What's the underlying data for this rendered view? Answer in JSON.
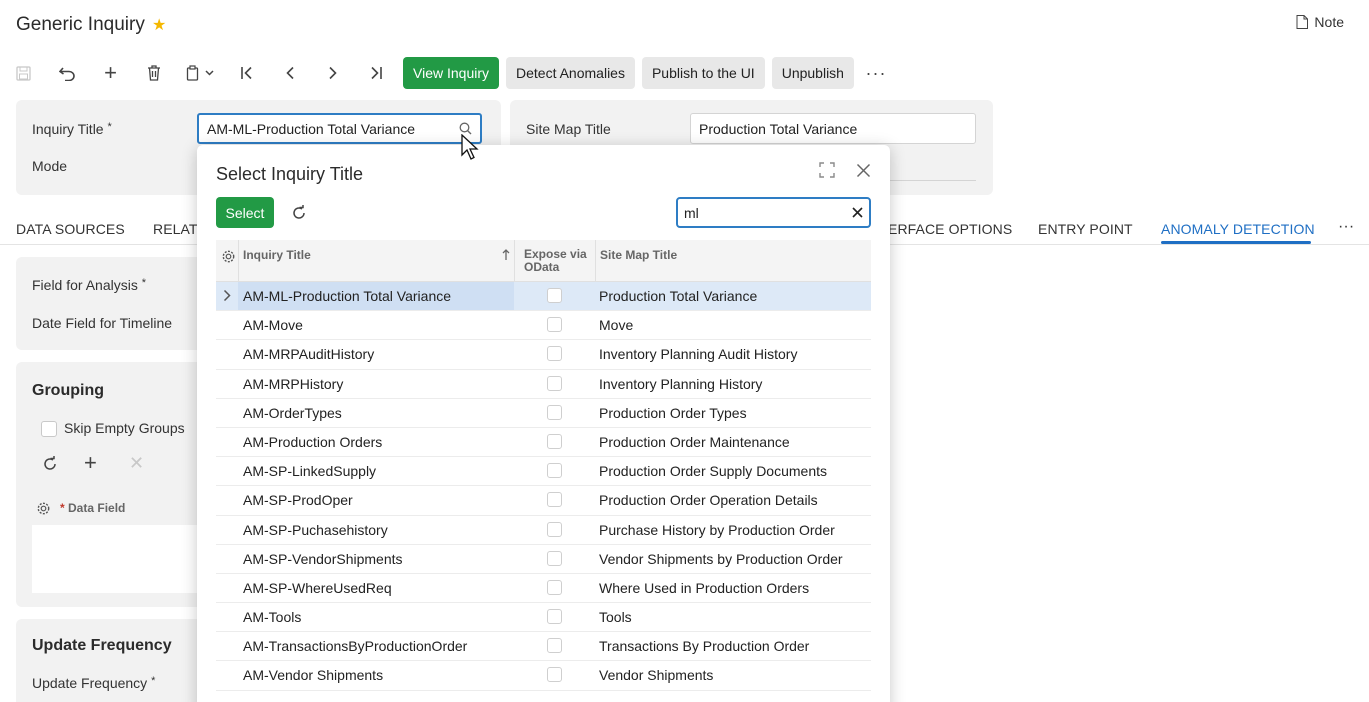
{
  "header": {
    "title": "Generic Inquiry",
    "note_label": "Note"
  },
  "toolbar": {
    "view_inquiry": "View Inquiry",
    "detect_anomalies": "Detect Anomalies",
    "publish": "Publish to the UI",
    "unpublish": "Unpublish",
    "more": "···"
  },
  "form": {
    "inquiry_title_label": "Inquiry Title",
    "inquiry_title_value": "AM-ML-Production Total Variance",
    "mode_label": "Mode",
    "site_map_title_label": "Site Map Title",
    "site_map_title_value": "Production Total Variance",
    "required_marker": "*"
  },
  "tabs": {
    "data_sources": "DATA SOURCES",
    "relations": "RELAT",
    "interface_options": "ERFACE OPTIONS",
    "entry_point": "ENTRY POINT",
    "anomaly_detection": "ANOMALY DETECTION",
    "more": "···"
  },
  "anomaly": {
    "field_for_analysis": "Field for Analysis",
    "date_field": "Date Field for Timeline",
    "grouping_title": "Grouping",
    "skip_empty_groups": "Skip Empty Groups",
    "data_field_header": "Data Field",
    "update_frequency_title": "Update Frequency",
    "update_frequency_label": "Update Frequency"
  },
  "modal": {
    "title": "Select Inquiry Title",
    "select_label": "Select",
    "search_value": "ml",
    "columns": {
      "inquiry_title": "Inquiry Title",
      "expose_odata": "Expose via OData",
      "site_map_title": "Site Map Title"
    },
    "rows": [
      {
        "inquiry_title": "AM-ML-Production Total Variance",
        "site_map_title": "Production Total Variance"
      },
      {
        "inquiry_title": "AM-Move",
        "site_map_title": "Move"
      },
      {
        "inquiry_title": "AM-MRPAuditHistory",
        "site_map_title": "Inventory Planning Audit History"
      },
      {
        "inquiry_title": "AM-MRPHistory",
        "site_map_title": "Inventory Planning History"
      },
      {
        "inquiry_title": "AM-OrderTypes",
        "site_map_title": "Production Order Types"
      },
      {
        "inquiry_title": "AM-Production Orders",
        "site_map_title": "Production Order Maintenance"
      },
      {
        "inquiry_title": "AM-SP-LinkedSupply",
        "site_map_title": "Production Order Supply Documents"
      },
      {
        "inquiry_title": "AM-SP-ProdOper",
        "site_map_title": "Production Order Operation Details"
      },
      {
        "inquiry_title": "AM-SP-Puchasehistory",
        "site_map_title": "Purchase History by Production Order"
      },
      {
        "inquiry_title": "AM-SP-VendorShipments",
        "site_map_title": "Vendor Shipments by Production Order"
      },
      {
        "inquiry_title": "AM-SP-WhereUsedReq",
        "site_map_title": "Where Used in Production Orders"
      },
      {
        "inquiry_title": "AM-Tools",
        "site_map_title": "Tools"
      },
      {
        "inquiry_title": "AM-TransactionsByProductionOrder",
        "site_map_title": "Transactions By Production Order"
      },
      {
        "inquiry_title": "AM-Vendor Shipments",
        "site_map_title": "Vendor Shipments"
      }
    ]
  },
  "colors": {
    "accent_green": "#229a45",
    "accent_blue": "#1f6fc4",
    "selected_row": "#dde9f7"
  }
}
